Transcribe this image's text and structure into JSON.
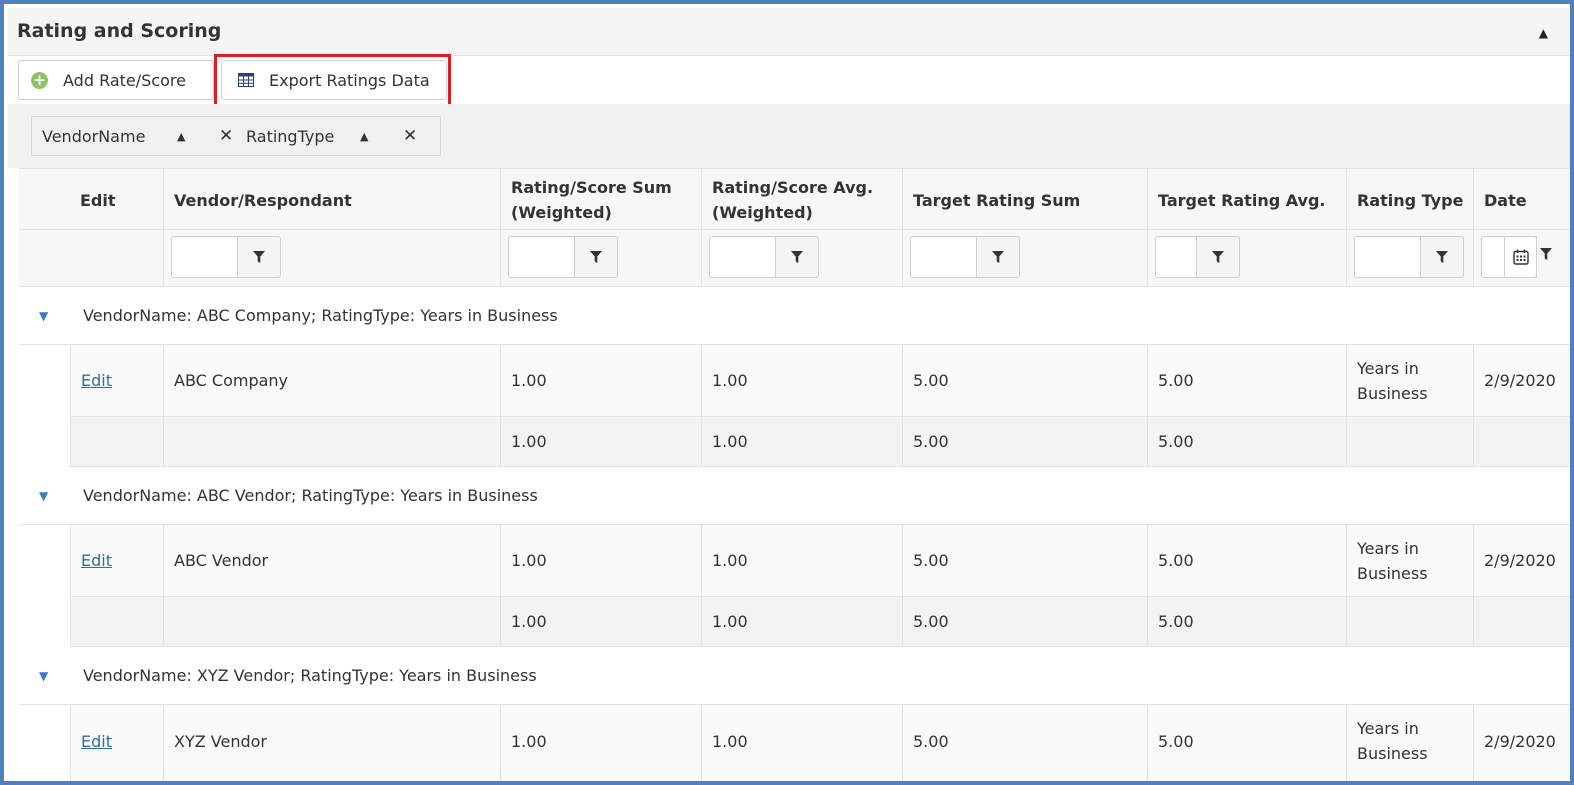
{
  "panel": {
    "title": "Rating and Scoring"
  },
  "toolbar": {
    "add_label": "Add Rate/Score",
    "export_label": "Export Ratings Data"
  },
  "grouping": {
    "chips": [
      {
        "label": "VendorName"
      },
      {
        "label": "RatingType"
      }
    ]
  },
  "columns": [
    {
      "id": "edit",
      "label": "Edit"
    },
    {
      "id": "vendor",
      "label": "Vendor/Respondant"
    },
    {
      "id": "sum_w",
      "label": "Rating/Score Sum\n(Weighted)"
    },
    {
      "id": "avg_w",
      "label": "Rating/Score Avg.\n(Weighted)"
    },
    {
      "id": "target_sum",
      "label": "Target Rating Sum"
    },
    {
      "id": "target_avg",
      "label": "Target Rating Avg."
    },
    {
      "id": "rating_type",
      "label": "Rating Type"
    },
    {
      "id": "date",
      "label": "Date"
    }
  ],
  "groups": [
    {
      "caption": "VendorName: ABC Company; RatingType: Years in Business",
      "row": {
        "edit": "Edit",
        "vendor": "ABC Company",
        "sum_w": "1.00",
        "avg_w": "1.00",
        "target_sum": "5.00",
        "target_avg": "5.00",
        "rating_type": "Years in\nBusiness",
        "date": "2/9/2020"
      },
      "totals": {
        "sum_w": "1.00",
        "avg_w": "1.00",
        "target_sum": "5.00",
        "target_avg": "5.00"
      }
    },
    {
      "caption": "VendorName: ABC Vendor; RatingType: Years in Business",
      "row": {
        "edit": "Edit",
        "vendor": "ABC Vendor",
        "sum_w": "1.00",
        "avg_w": "1.00",
        "target_sum": "5.00",
        "target_avg": "5.00",
        "rating_type": "Years in\nBusiness",
        "date": "2/9/2020"
      },
      "totals": {
        "sum_w": "1.00",
        "avg_w": "1.00",
        "target_sum": "5.00",
        "target_avg": "5.00"
      }
    },
    {
      "caption": "VendorName: XYZ Vendor; RatingType: Years in Business",
      "row": {
        "edit": "Edit",
        "vendor": "XYZ Vendor",
        "sum_w": "1.00",
        "avg_w": "1.00",
        "target_sum": "5.00",
        "target_avg": "5.00",
        "rating_type": "Years in\nBusiness",
        "date": "2/9/2020"
      },
      "totals": null
    }
  ],
  "colors": {
    "frame_border": "#4f81bd",
    "highlight": "#e02020",
    "link": "#2f6da4",
    "add_icon": "#8cc265",
    "caret": "#3a7cc1"
  }
}
